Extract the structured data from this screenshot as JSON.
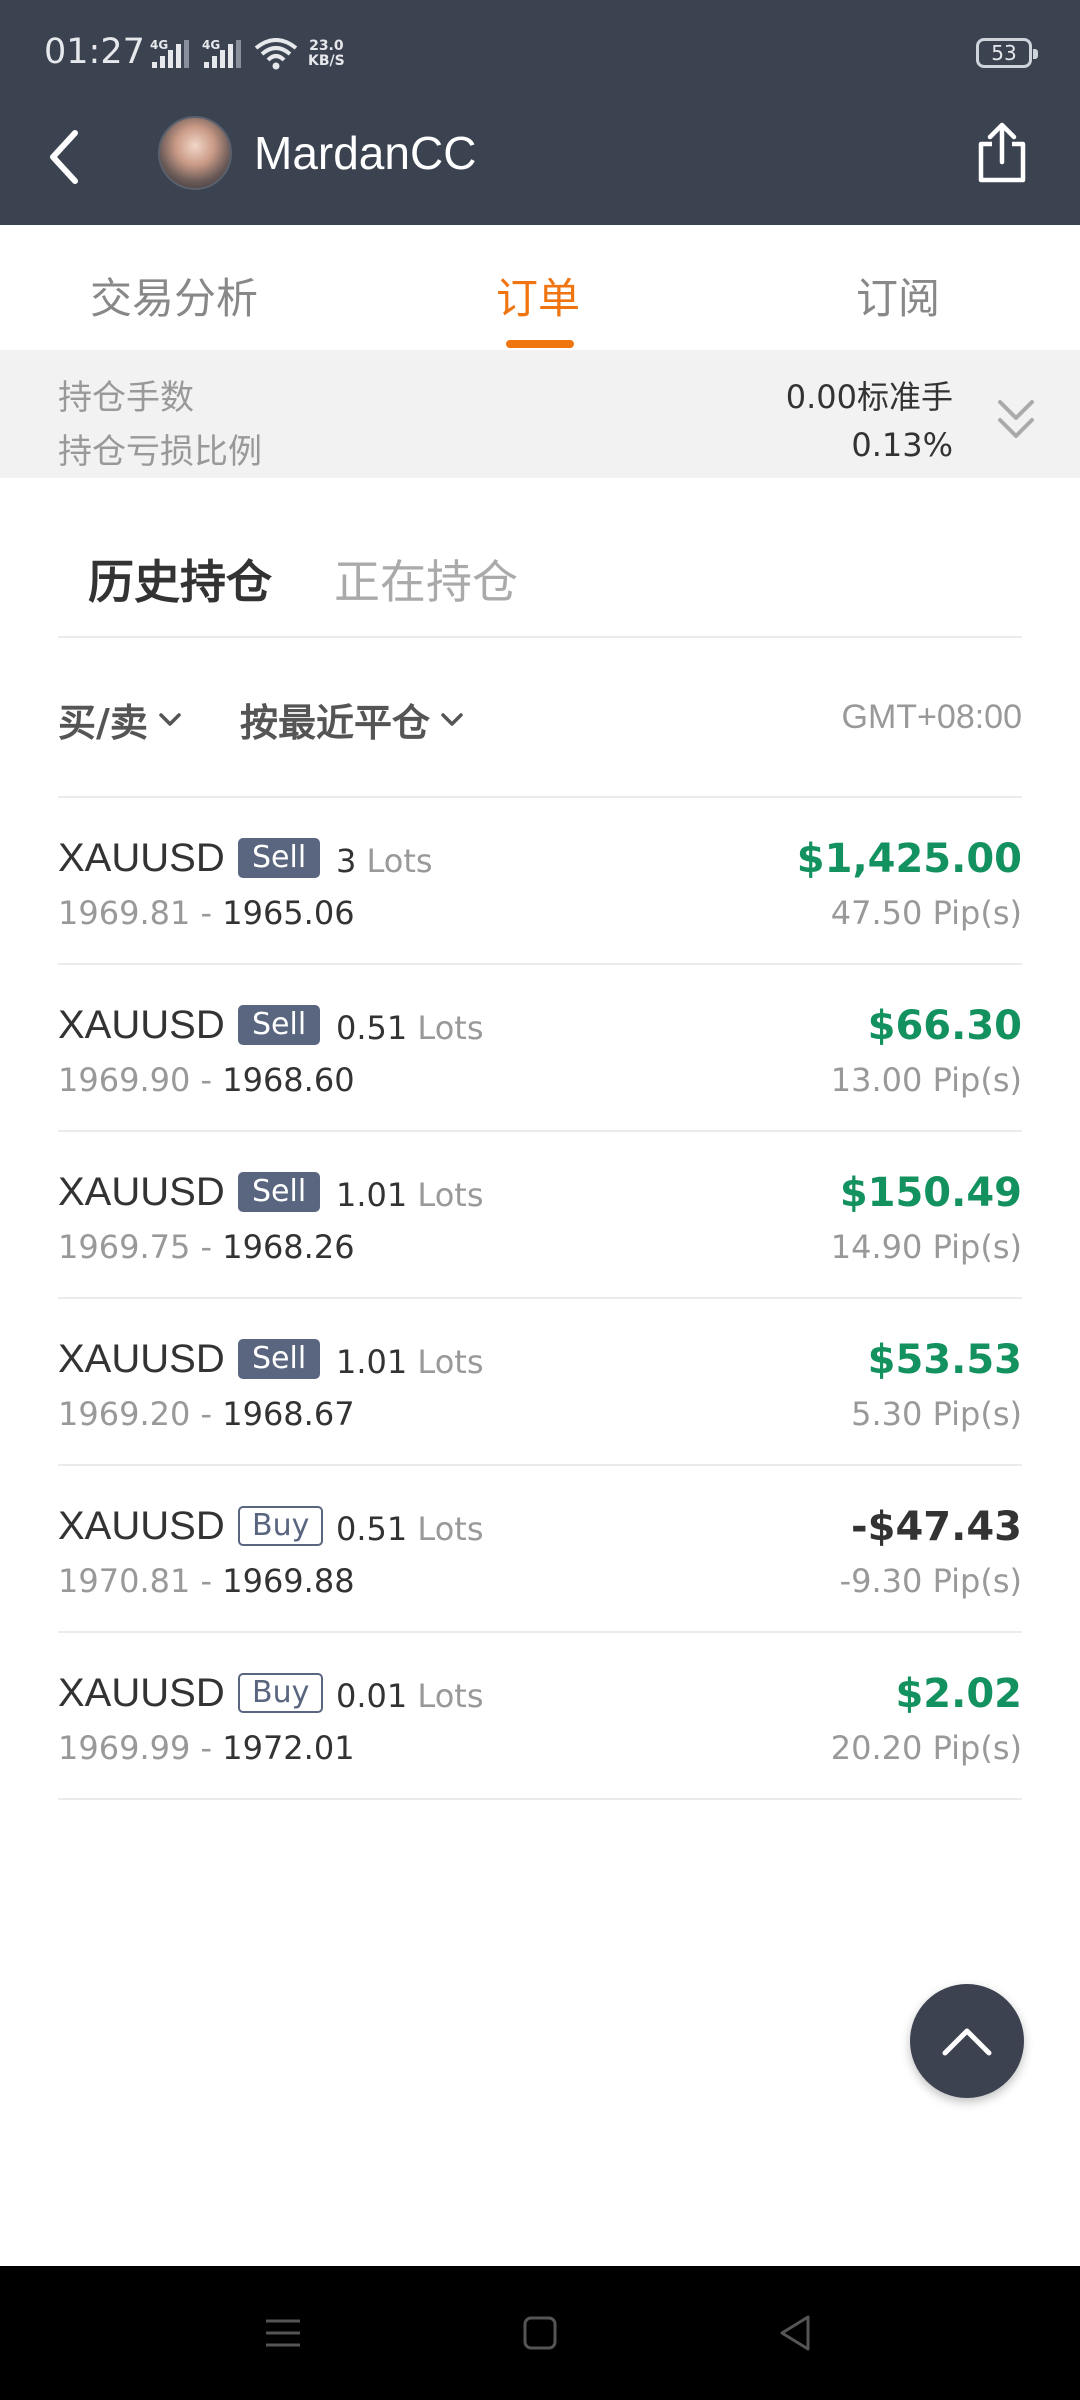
{
  "status_bar": {
    "time": "01:27",
    "network_1": "4G",
    "network_2": "4G",
    "speed_value": "23.0",
    "speed_unit": "KB/S",
    "battery": "53"
  },
  "nav": {
    "username": "MardanCC"
  },
  "tabs": [
    {
      "label": "交易分析"
    },
    {
      "label": "订单"
    },
    {
      "label": "订阅"
    }
  ],
  "summary": {
    "lots_label": "持仓手数",
    "lots_value": "0.00标准手",
    "loss_ratio_label": "持仓亏损比例",
    "loss_ratio_value": "0.13%"
  },
  "subtabs": [
    {
      "label": "历史持仓"
    },
    {
      "label": "正在持仓"
    }
  ],
  "filters": {
    "side_label": "买/卖",
    "sort_label": "按最近平仓",
    "timezone": "GMT+08:00"
  },
  "orders": [
    {
      "symbol": "XAUUSD",
      "side": "Sell",
      "lots": "3",
      "lots_unit": "Lots",
      "open": "1969.81",
      "sep": "-",
      "close": "1965.06",
      "profit": "$1,425.00",
      "pips": "47.50 Pip(s)"
    },
    {
      "symbol": "XAUUSD",
      "side": "Sell",
      "lots": "0.51",
      "lots_unit": "Lots",
      "open": "1969.90",
      "sep": "-",
      "close": "1968.60",
      "profit": "$66.30",
      "pips": "13.00 Pip(s)"
    },
    {
      "symbol": "XAUUSD",
      "side": "Sell",
      "lots": "1.01",
      "lots_unit": "Lots",
      "open": "1969.75",
      "sep": "-",
      "close": "1968.26",
      "profit": "$150.49",
      "pips": "14.90 Pip(s)"
    },
    {
      "symbol": "XAUUSD",
      "side": "Sell",
      "lots": "1.01",
      "lots_unit": "Lots",
      "open": "1969.20",
      "sep": "-",
      "close": "1968.67",
      "profit": "$53.53",
      "pips": "5.30 Pip(s)"
    },
    {
      "symbol": "XAUUSD",
      "side": "Buy",
      "lots": "0.51",
      "lots_unit": "Lots",
      "open": "1970.81",
      "sep": "-",
      "close": "1969.88",
      "profit": "-$47.43",
      "pips": "-9.30 Pip(s)"
    },
    {
      "symbol": "XAUUSD",
      "side": "Buy",
      "lots": "0.01",
      "lots_unit": "Lots",
      "open": "1969.99",
      "sep": "-",
      "close": "1972.01",
      "profit": "$2.02",
      "pips": "20.20 Pip(s)"
    }
  ],
  "colors": {
    "header_bg": "#3b4250",
    "accent": "#f07410",
    "profit_positive": "#13915f",
    "profit_negative": "#333333",
    "sell_badge": "#5a6680"
  },
  "icons": {
    "back": "chevron-left-icon",
    "share": "share-icon",
    "expand": "double-chevron-down-icon",
    "dropdown": "chevron-down-icon",
    "scroll_top": "chevron-up-icon"
  }
}
